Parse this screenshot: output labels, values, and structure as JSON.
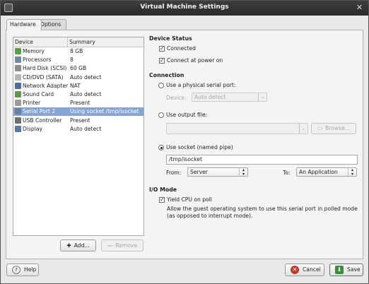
{
  "window": {
    "title": "Virtual Machine Settings"
  },
  "tabs": [
    {
      "label": "Hardware"
    },
    {
      "label": "Options"
    }
  ],
  "device_list": {
    "columns": [
      "Device",
      "Summary"
    ],
    "rows": [
      {
        "name": "Memory",
        "summary": "8 GB",
        "icon": "memory-icon",
        "color": "#5aa23c"
      },
      {
        "name": "Processors",
        "summary": "8",
        "icon": "processor-icon",
        "color": "#6e8aa8"
      },
      {
        "name": "Hard Disk (SCSI)",
        "summary": "60 GB",
        "icon": "hard-disk-icon",
        "color": "#8c8c8c"
      },
      {
        "name": "CD/DVD (SATA)",
        "summary": "Auto detect",
        "icon": "cd-dvd-icon",
        "color": "#b5b5b5"
      },
      {
        "name": "Network Adapter",
        "summary": "NAT",
        "icon": "network-adapter-icon",
        "color": "#4c6f9e"
      },
      {
        "name": "Sound Card",
        "summary": "Auto detect",
        "icon": "sound-card-icon",
        "color": "#5f9a44"
      },
      {
        "name": "Printer",
        "summary": "Present",
        "icon": "printer-icon",
        "color": "#9a9a9a"
      },
      {
        "name": "Serial Port 2",
        "summary": "Using socket /tmp/isocket",
        "icon": "serial-port-icon",
        "color": "#6b7f99"
      },
      {
        "name": "USB Controller",
        "summary": "Present",
        "icon": "usb-controller-icon",
        "color": "#707070"
      },
      {
        "name": "Display",
        "summary": "Auto detect",
        "icon": "display-icon",
        "color": "#557aa6"
      }
    ],
    "selected_index": 7,
    "add_label": "Add...",
    "remove_label": "Remove"
  },
  "device_status": {
    "heading": "Device Status",
    "connected_label": "Connected",
    "connected": true,
    "power_on_label": "Connect at power on",
    "power_on": true
  },
  "connection": {
    "heading": "Connection",
    "physical_label": "Use a physical serial port:",
    "device_label": "Device:",
    "device_value": "Auto detect",
    "output_file_label": "Use output file:",
    "output_file_value": "",
    "browse_label": "Browse...",
    "socket_label": "Use socket (named pipe)",
    "socket_path": "/tmp/isocket",
    "from_label": "From:",
    "from_value": "Server",
    "to_label": "To:",
    "to_value": "An Application",
    "selected": "socket"
  },
  "io_mode": {
    "heading": "I/O Mode",
    "yield_label": "Yield CPU on poll",
    "yield": true,
    "description": "Allow the guest operating system to use this serial port in polled mode (as opposed to interrupt mode)."
  },
  "footer": {
    "help_label": "Help",
    "cancel_label": "Cancel",
    "save_label": "Save"
  },
  "colors": {
    "selection": "#86a4d1",
    "titlebar": "#333333",
    "cancel_icon": "#c0392b",
    "save_icon": "#3a8f3a"
  }
}
